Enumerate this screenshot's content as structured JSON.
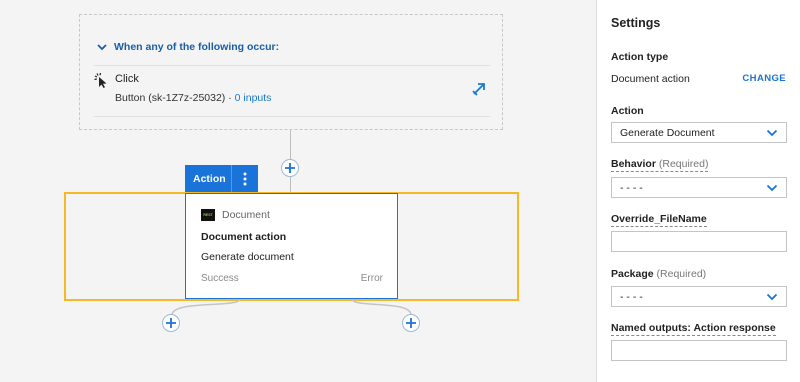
{
  "trigger": {
    "header": "When any of the following occur:",
    "event_title": "Click",
    "event_source": "Button (sk-1Z7z-25032) · ",
    "inputs_link": "0 inputs"
  },
  "action": {
    "tab_label": "Action",
    "card": {
      "type_label": "Document",
      "icon_text": "REST",
      "title": "Document action",
      "description": "Generate document",
      "success_label": "Success",
      "error_label": "Error"
    }
  },
  "settings": {
    "title": "Settings",
    "action_type_label": "Action type",
    "action_type_value": "Document action",
    "change_label": "CHANGE",
    "action_label": "Action",
    "action_value": "Generate Document",
    "behavior_label": "Behavior",
    "behavior_required": "(Required)",
    "behavior_value": "- - - -",
    "override_label": "Override_FileName",
    "override_value": "",
    "package_label": "Package",
    "package_required": "(Required)",
    "package_value": "- - - -",
    "named_outputs_label": "Named outputs: Action response",
    "named_outputs_value": ""
  },
  "colors": {
    "accent": "#1a73d8",
    "highlight": "#f5b925",
    "link": "#1a7ad0"
  }
}
